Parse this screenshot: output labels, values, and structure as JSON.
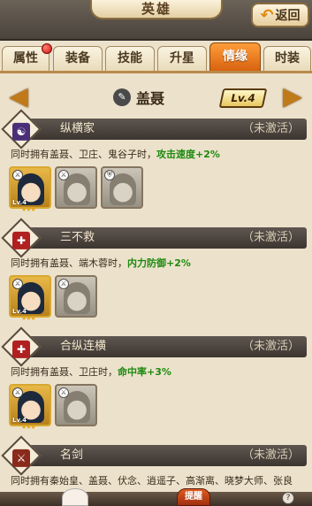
{
  "header": {
    "title": "英雄",
    "back_label": "返回"
  },
  "tabs": [
    {
      "label": "属性",
      "active": false,
      "has_dot": true
    },
    {
      "label": "装备",
      "active": false
    },
    {
      "label": "技能",
      "active": false
    },
    {
      "label": "升星",
      "active": false
    },
    {
      "label": "情缘",
      "active": true
    },
    {
      "label": "时装",
      "active": false
    }
  ],
  "hero": {
    "name": "盖聂",
    "level": "Lv.4"
  },
  "bonds": [
    {
      "title": "纵横家",
      "status": "（未激活）",
      "desc_prefix": "同时拥有盖聂、卫庄、鬼谷子时，",
      "bonus": "攻击速度+2%",
      "portraits": [
        {
          "owned": true,
          "level": "Lv.4",
          "stars": "★★★"
        },
        {
          "owned": false
        },
        {
          "owned": false
        }
      ]
    },
    {
      "title": "三不救",
      "status": "（未激活）",
      "desc_prefix": "同时拥有盖聂、端木蓉时，",
      "bonus": "内力防御+2%",
      "portraits": [
        {
          "owned": true,
          "level": "Lv.4",
          "stars": "★★★"
        },
        {
          "owned": false
        }
      ]
    },
    {
      "title": "合纵连横",
      "status": "（未激活）",
      "desc_prefix": "同时拥有盖聂、卫庄时，",
      "bonus": "命中率+3%",
      "portraits": [
        {
          "owned": true,
          "level": "Lv.4",
          "stars": "★★★"
        },
        {
          "owned": false
        }
      ]
    },
    {
      "title": "名剑",
      "status": "（未激活）",
      "desc_prefix": "同时拥有秦始皇、盖聂、伏念、逍遥子、高渐离、晓梦大师、张良",
      "bonus": "",
      "portraits": []
    }
  ],
  "bottom": {
    "button_label": "提醒",
    "help": "?"
  },
  "colors": {
    "active_tab": "#f07a20",
    "bonus_text": "#1e8a10",
    "header_bar": "#4b443c"
  }
}
